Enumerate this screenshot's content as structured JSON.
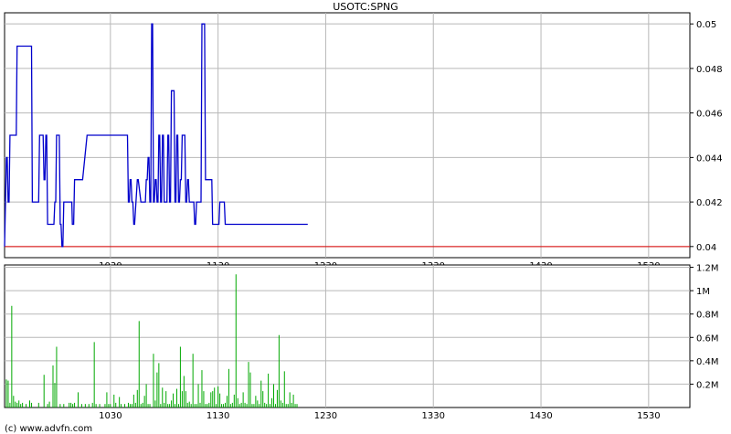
{
  "chart_data": [
    {
      "type": "line",
      "title": "USOTC:SPNG",
      "credit": "(c) www.advfn.com",
      "x_ticks": [
        "1030",
        "1130",
        "1230",
        "1330",
        "1430",
        "1530"
      ],
      "x_tick_minutes": [
        630,
        690,
        750,
        810,
        870,
        930
      ],
      "xlim_minutes": [
        571,
        953
      ],
      "y_ticks": [
        "0.04",
        "0.042",
        "0.044",
        "0.046",
        "0.048",
        "0.05"
      ],
      "y_tick_values": [
        0.04,
        0.042,
        0.044,
        0.046,
        0.048,
        0.05
      ],
      "ylim": [
        0.0395,
        0.0505
      ],
      "grid": true,
      "reference_line": {
        "value": 0.04,
        "color": "#dd0000"
      },
      "series": [
        {
          "color": "#0000cc",
          "x_minutes": [
            571,
            572,
            572.5,
            573,
            573.5,
            574,
            574.5,
            576,
            576.5,
            577,
            577.5,
            578,
            582,
            586,
            586.5,
            590,
            590.5,
            592,
            592.5,
            593,
            593.5,
            594,
            594.5,
            595,
            595.5,
            596,
            596.5,
            597,
            597.5,
            598,
            598.5,
            599,
            599.5,
            600,
            600.5,
            601,
            601.5,
            602,
            602.5,
            603,
            603.5,
            604,
            604.5,
            605,
            605.5,
            608,
            608.5,
            608.8,
            609,
            609.5,
            610,
            610.5,
            612,
            612.5,
            614,
            614.5,
            617,
            617.5,
            618,
            618.5,
            619,
            619.5,
            622,
            622.5,
            624,
            624.5,
            625,
            625.5,
            628,
            628.5,
            629,
            629.5,
            630,
            630.5,
            631,
            631.5,
            632,
            632.5,
            633,
            633.5,
            634,
            634.5,
            636,
            636.5,
            637,
            637.5,
            639,
            639.5,
            640,
            640.5,
            641,
            641.5,
            642,
            642.5,
            643,
            643.5,
            645,
            645.5,
            647,
            647.5,
            648,
            648.5,
            649,
            649.5,
            650,
            650.5,
            651,
            651.5,
            652,
            652.5,
            653,
            653.5,
            654,
            654.5,
            655,
            655.5,
            656,
            656.5,
            657,
            657.5,
            658,
            658.5,
            659,
            659.5,
            660,
            660.5,
            661,
            661.5,
            662,
            662.5,
            663,
            663.5,
            664,
            664.5,
            665,
            665.5,
            666,
            666.5,
            667,
            667.5,
            668,
            668.5,
            669,
            669.5,
            670,
            670.5,
            671,
            671.5,
            672,
            672.5,
            673,
            673.5,
            674,
            674.5,
            675,
            675.5,
            676,
            676.5,
            677,
            677.5,
            678,
            678.5,
            679,
            679.5,
            680,
            680.5,
            681,
            681.5,
            682,
            682.5,
            683,
            683.5,
            684,
            684.5,
            685,
            685.5,
            686,
            686.5,
            687,
            687.5,
            688,
            688.5,
            689,
            689.5,
            690,
            690.5,
            691,
            691.5,
            692,
            692.5,
            693,
            693.5,
            694,
            694.5,
            695,
            695.5,
            696,
            696.5,
            697,
            697.5,
            698,
            698.5,
            699,
            699.5,
            700,
            700.5,
            701,
            701.5,
            702,
            702.5,
            703,
            703.5,
            704,
            704.5,
            705,
            705.5,
            706,
            706.5,
            707,
            707.5,
            708,
            708.5,
            709,
            709.5,
            710,
            710.5,
            711,
            711.5,
            712,
            712.5,
            713,
            713.5,
            714,
            714.5,
            715,
            715.5,
            716,
            716.5,
            717,
            717.5,
            718,
            718.5,
            719,
            719.5,
            720,
            720.5,
            721,
            721.5,
            722,
            722.5,
            723,
            723.5,
            724,
            724.5,
            725,
            725.5,
            726,
            726.5,
            727,
            727.5,
            728,
            728.5,
            729,
            729.5,
            730,
            730.5,
            731,
            731.5,
            732,
            732.5,
            733,
            733.5,
            734,
            734.5,
            735,
            735.5,
            736,
            736.5,
            737,
            737.5,
            738,
            738.5,
            739,
            739.5,
            740
          ],
          "y": [
            0.04,
            0.044,
            0.044,
            0.042,
            0.042,
            0.045,
            0.045,
            0.045,
            0.045,
            0.045,
            0.045,
            0.049,
            0.049,
            0.049,
            0.042,
            0.042,
            0.045,
            0.045,
            0.045,
            0.043,
            0.043,
            0.045,
            0.045,
            0.041,
            0.041,
            0.041,
            0.041,
            0.041,
            0.041,
            0.041,
            0.041,
            0.042,
            0.042,
            0.045,
            0.045,
            0.045,
            0.045,
            0.041,
            0.041,
            0.04,
            0.04,
            0.042,
            0.042,
            0.042,
            0.042,
            0.042,
            0.042,
            0.041,
            0.041,
            0.041,
            0.043,
            0.043,
            0.043,
            0.043,
            0.043,
            0.043,
            0.045,
            0.045,
            0.045,
            0.045,
            0.045,
            0.045,
            0.045,
            0.045,
            0.045,
            0.045,
            0.045,
            0.045,
            0.045,
            0.045,
            0.045,
            0.045,
            0.045,
            0.045,
            0.045,
            0.045,
            0.045,
            0.045,
            0.045,
            0.045,
            0.045,
            0.045,
            0.045,
            0.045,
            0.045,
            0.045,
            0.045,
            0.045,
            0.042,
            0.042,
            0.043,
            0.043,
            0.042,
            0.042,
            0.041,
            0.041,
            0.043,
            0.043,
            0.042,
            0.042,
            0.042,
            0.042,
            0.042,
            0.042,
            0.043,
            0.043,
            0.044,
            0.044,
            0.042,
            0.042,
            0.05,
            0.05,
            0.042,
            0.042,
            0.043,
            0.043,
            0.042,
            0.042,
            0.045,
            0.045,
            0.042,
            0.042,
            0.045,
            0.045,
            0.042,
            0.042,
            0.042,
            0.042,
            0.045,
            0.045,
            0.042,
            0.042,
            0.047,
            0.047,
            0.047,
            0.047,
            0.042,
            0.042,
            0.045,
            0.045,
            0.042,
            0.042,
            0.043,
            0.043,
            0.045,
            0.045,
            0.045,
            0.045,
            0.042,
            0.042,
            0.043,
            0.043,
            0.042,
            0.042,
            0.042,
            0.042,
            0.042,
            0.042,
            0.041,
            0.041,
            0.042,
            0.042,
            0.042,
            0.042,
            0.042,
            0.042,
            0.05,
            0.05,
            0.05,
            0.05,
            0.043,
            0.043,
            0.043,
            0.043,
            0.043,
            0.043,
            0.043,
            0.043,
            0.041,
            0.041,
            0.041,
            0.041,
            0.041,
            0.041,
            0.041,
            0.041,
            0.042,
            0.042,
            0.042,
            0.042,
            0.042,
            0.042,
            0.041,
            0.041,
            0.041,
            0.041,
            0.041,
            0.041,
            0.041,
            0.041,
            0.041,
            0.041,
            0.041,
            0.041,
            0.041,
            0.041,
            0.041,
            0.041,
            0.041,
            0.041,
            0.041,
            0.041,
            0.041,
            0.041,
            0.041,
            0.041,
            0.041,
            0.041,
            0.041,
            0.041,
            0.041,
            0.041,
            0.041,
            0.041,
            0.041,
            0.041,
            0.041,
            0.041,
            0.041,
            0.041,
            0.041,
            0.041,
            0.041,
            0.041,
            0.041,
            0.041,
            0.041,
            0.041,
            0.041,
            0.041,
            0.041,
            0.041,
            0.041,
            0.041,
            0.041,
            0.041,
            0.041,
            0.041,
            0.041,
            0.041,
            0.041,
            0.041,
            0.041,
            0.041,
            0.041,
            0.041,
            0.041,
            0.041,
            0.041,
            0.041,
            0.041,
            0.041,
            0.041,
            0.041,
            0.041,
            0.041,
            0.041,
            0.041,
            0.041,
            0.041,
            0.041,
            0.041,
            0.041,
            0.041,
            0.041,
            0.041,
            0.041,
            0.041,
            0.041,
            0.041,
            0.041,
            0.041,
            0.041,
            0.041,
            0.041,
            0.041,
            0.041
          ]
        }
      ]
    },
    {
      "type": "bar",
      "title": "",
      "x_ticks": [
        "1030",
        "1130",
        "1230",
        "1330",
        "1430",
        "1530"
      ],
      "x_tick_minutes": [
        630,
        690,
        750,
        810,
        870,
        930
      ],
      "xlim_minutes": [
        571,
        953
      ],
      "y_ticks": [
        "0.2M",
        "0.4M",
        "0.6M",
        "0.8M",
        "1M",
        "1.2M"
      ],
      "y_tick_values": [
        200000,
        400000,
        600000,
        800000,
        1000000,
        1200000
      ],
      "ylim": [
        0,
        1220000
      ],
      "grid": true,
      "color": "#00a800",
      "x_minutes": [
        572,
        573,
        574,
        575,
        576,
        577,
        578,
        579,
        580,
        581,
        583,
        585,
        586,
        590,
        593,
        595,
        596,
        598,
        599,
        600,
        602,
        604,
        607,
        608,
        609,
        610,
        612,
        614,
        616,
        618,
        620,
        621,
        622,
        624,
        627,
        628,
        629,
        630,
        632,
        633,
        635,
        636,
        638,
        640,
        641,
        642,
        643,
        644,
        645,
        646,
        647,
        648,
        649,
        650,
        651,
        652,
        654,
        655,
        656,
        657,
        658,
        659,
        660,
        661,
        662,
        663,
        664,
        665,
        666,
        667,
        668,
        669,
        670,
        671,
        672,
        673,
        674,
        675,
        676,
        677,
        678,
        679,
        680,
        681,
        682,
        683,
        684,
        685,
        686,
        687,
        688,
        689,
        690,
        691,
        692,
        693,
        694,
        695,
        696,
        697,
        698,
        699,
        700,
        701,
        702,
        703,
        704,
        705,
        706,
        707,
        708,
        709,
        710,
        711,
        712,
        713,
        714,
        715,
        716,
        717,
        718,
        719,
        720,
        721,
        722,
        723,
        724,
        725,
        726,
        727,
        728,
        729,
        730,
        731,
        732,
        733,
        734
      ],
      "values": [
        240000,
        230000,
        40000,
        870000,
        100000,
        50000,
        40000,
        60000,
        30000,
        40000,
        30000,
        60000,
        40000,
        40000,
        280000,
        30000,
        50000,
        360000,
        210000,
        520000,
        30000,
        30000,
        40000,
        40000,
        30000,
        40000,
        130000,
        30000,
        30000,
        30000,
        40000,
        560000,
        30000,
        30000,
        30000,
        130000,
        30000,
        30000,
        110000,
        40000,
        90000,
        30000,
        30000,
        40000,
        30000,
        30000,
        110000,
        40000,
        150000,
        740000,
        30000,
        40000,
        100000,
        200000,
        30000,
        30000,
        460000,
        60000,
        300000,
        380000,
        30000,
        170000,
        40000,
        140000,
        30000,
        30000,
        60000,
        120000,
        30000,
        160000,
        30000,
        520000,
        140000,
        270000,
        140000,
        40000,
        50000,
        30000,
        460000,
        30000,
        30000,
        200000,
        40000,
        320000,
        140000,
        30000,
        30000,
        40000,
        130000,
        140000,
        170000,
        30000,
        180000,
        120000,
        30000,
        30000,
        40000,
        100000,
        330000,
        30000,
        40000,
        110000,
        1140000,
        80000,
        30000,
        40000,
        130000,
        40000,
        30000,
        390000,
        300000,
        30000,
        30000,
        100000,
        60000,
        30000,
        230000,
        140000,
        40000,
        30000,
        290000,
        30000,
        80000,
        200000,
        30000,
        150000,
        620000,
        60000,
        40000,
        310000,
        30000,
        30000,
        130000,
        40000,
        110000,
        30000,
        30000
      ]
    }
  ]
}
